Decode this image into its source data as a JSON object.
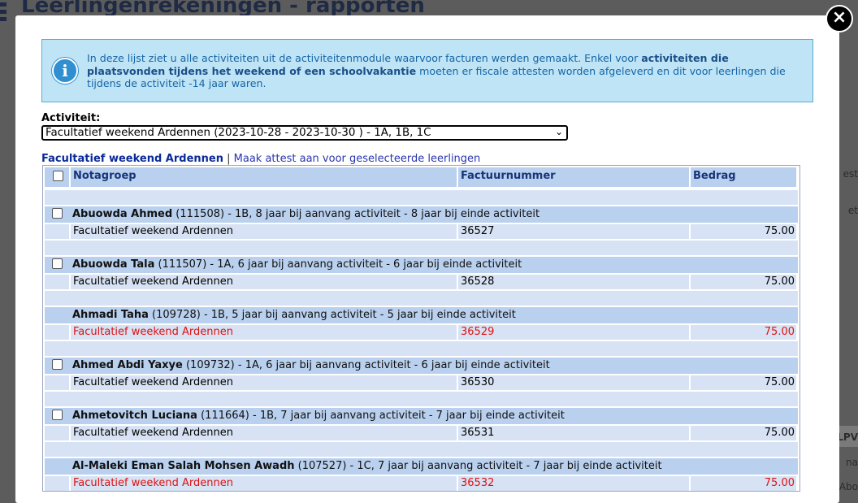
{
  "background": {
    "title": "Leerlingenrekeningen - rapporten",
    "right_snippets": [
      "est",
      "et",
      "LPV",
      "na",
      "Abo"
    ]
  },
  "modal": {
    "close_label": "×",
    "info_icon": "info-icon",
    "info": {
      "part1": "In deze lijst ziet u alle activiteiten uit de activiteitenmodule waarvoor facturen werden gemaakt. Enkel voor ",
      "bold": "activiteiten die plaatsvonden tijdens het weekend of een schoolvakantie",
      "part2": " moeten er fiscale attesten worden afgeleverd en dit voor leerlingen die tijdens de activiteit -14 jaar waren."
    },
    "activity_label": "Activiteit:",
    "activity_selected": "Facultatief weekend Ardennen (2023-10-28 - 2023-10-30 ) - 1A, 1B, 1C",
    "links": {
      "current": "Facultatief weekend Ardennen",
      "separator": "|",
      "action": "Maak attest aan voor geselecteerde leerlingen"
    },
    "table": {
      "headers": {
        "nota": "Notagroep",
        "factuur": "Factuurnummer",
        "bedrag": "Bedrag"
      },
      "students": [
        {
          "name": "Abuowda Ahmed",
          "details": " (111508) - 1B, 8 jaar bij aanvang activiteit - 8 jaar bij einde activiteit",
          "checkbox": true,
          "invoice_desc": "Facultatief weekend Ardennen",
          "invoice_no": "36527",
          "amount": "75.00",
          "highlight": false
        },
        {
          "name": "Abuowda Tala",
          "details": " (111507) - 1A, 6 jaar bij aanvang activiteit - 6 jaar bij einde activiteit",
          "checkbox": true,
          "invoice_desc": "Facultatief weekend Ardennen",
          "invoice_no": "36528",
          "amount": "75.00",
          "highlight": false
        },
        {
          "name": "Ahmadi Taha",
          "details": " (109728) - 1B, 5 jaar bij aanvang activiteit - 5 jaar bij einde activiteit",
          "checkbox": false,
          "invoice_desc": "Facultatief weekend Ardennen",
          "invoice_no": "36529",
          "amount": "75.00",
          "highlight": true
        },
        {
          "name": "Ahmed Abdi Yaxye",
          "details": " (109732) - 1A, 6 jaar bij aanvang activiteit - 6 jaar bij einde activiteit",
          "checkbox": true,
          "invoice_desc": "Facultatief weekend Ardennen",
          "invoice_no": "36530",
          "amount": "75.00",
          "highlight": false
        },
        {
          "name": "Ahmetovitch Luciana",
          "details": " (111664) - 1B, 7 jaar bij aanvang activiteit - 7 jaar bij einde activiteit",
          "checkbox": true,
          "invoice_desc": "Facultatief weekend Ardennen",
          "invoice_no": "36531",
          "amount": "75.00",
          "highlight": false
        },
        {
          "name": "Al-Maleki Eman Salah Mohsen Awadh",
          "details": " (107527) - 1C, 7 jaar bij aanvang activiteit - 7 jaar bij einde activiteit",
          "checkbox": false,
          "invoice_desc": "Facultatief weekend Ardennen",
          "invoice_no": "36532",
          "amount": "75.00",
          "highlight": true
        }
      ]
    }
  },
  "colors": {
    "overlay": "#5c5c5c",
    "info_bg": "#bfe4f5",
    "info_text": "#1565a8",
    "row_dark": "#b9d0ee",
    "row_light": "#d7e3f4",
    "highlight": "#e01010"
  }
}
